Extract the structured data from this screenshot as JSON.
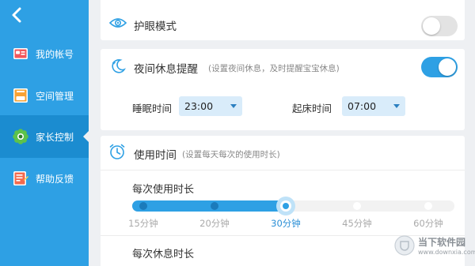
{
  "colors": {
    "accent": "#2ea0e4",
    "sidebar_active": "#1b8cd0",
    "background": "#eef0f3"
  },
  "sidebar": {
    "back_icon": "back-arrow-icon",
    "items": [
      {
        "label": "我的帐号",
        "icon": "account-card-icon",
        "active": false
      },
      {
        "label": "空间管理",
        "icon": "storage-icon",
        "active": false
      },
      {
        "label": "家长控制",
        "icon": "flower-gear-icon",
        "active": true
      },
      {
        "label": "帮助反馈",
        "icon": "feedback-note-icon",
        "active": false
      }
    ]
  },
  "eye_mode": {
    "title": "护眼模式",
    "icon": "eye-icon",
    "enabled": false
  },
  "night_rest": {
    "title": "夜间休息提醒",
    "hint": "(设置夜间休息，及时提醒宝宝休息)",
    "icon": "moon-icon",
    "enabled": true,
    "sleep_label": "睡眠时间",
    "sleep_value": "23:00",
    "wake_label": "起床时间",
    "wake_value": "07:00"
  },
  "usage": {
    "title": "使用时间",
    "hint": "(设置每天每次的使用时长)",
    "icon": "clock-icon",
    "session_label": "每次使用时长",
    "options": [
      "15分钟",
      "20分钟",
      "30分钟",
      "45分钟",
      "60分钟"
    ],
    "selected_index": 2,
    "rest_label": "每次休息时长"
  },
  "watermark": {
    "text": "当下软件园",
    "sub": "www.downxia.com"
  }
}
